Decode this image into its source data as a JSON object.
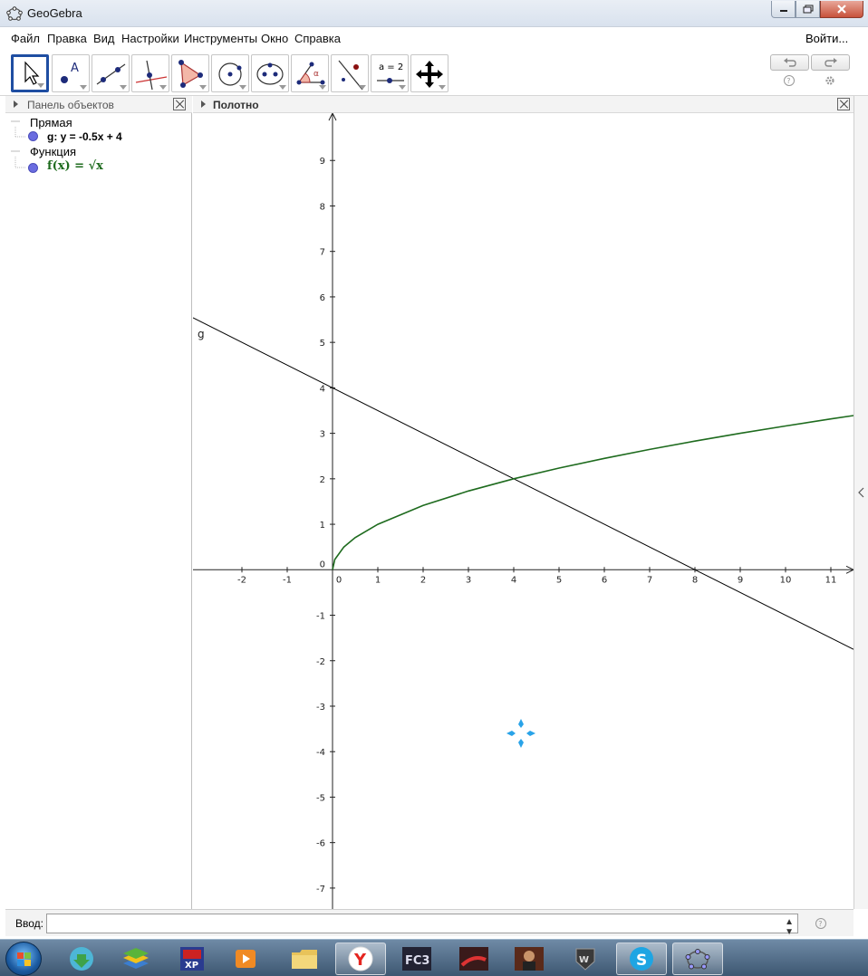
{
  "window": {
    "title": "GeoGebra"
  },
  "menu": {
    "items": [
      "Файл",
      "Правка",
      "Вид",
      "Настройки",
      "Инструменты",
      "Окно",
      "Справка"
    ],
    "login": "Войти..."
  },
  "toolbar": {
    "tools": [
      {
        "icon": "move-arrow-icon",
        "active": true
      },
      {
        "icon": "new-point-icon"
      },
      {
        "icon": "line-through-two-points-icon"
      },
      {
        "icon": "perpendicular-line-icon"
      },
      {
        "icon": "polygon-icon"
      },
      {
        "icon": "circle-with-center-icon"
      },
      {
        "icon": "ellipse-icon"
      },
      {
        "icon": "angle-icon"
      },
      {
        "icon": "reflect-about-line-icon"
      },
      {
        "icon": "slider-icon",
        "text": "a = 2"
      },
      {
        "icon": "move-graphics-view-icon"
      }
    ],
    "undo_icon": "undo-icon",
    "redo_icon": "redo-icon"
  },
  "algebra_panel": {
    "title": "Панель объектов",
    "groups": [
      {
        "label": "Прямая",
        "items": [
          {
            "text": "g: y = -0.5x + 4",
            "color": "#000000"
          }
        ]
      },
      {
        "label": "Функция",
        "items": [
          {
            "text": "f(x) = √x",
            "color": "#1e6b1e"
          }
        ]
      }
    ]
  },
  "graphics_panel": {
    "title": "Полотно",
    "line_label": "g"
  },
  "chart_data": {
    "type": "line",
    "x_ticks": [
      -2,
      -1,
      0,
      1,
      2,
      3,
      4,
      5,
      6,
      7,
      8,
      9,
      10,
      11
    ],
    "y_ticks": [
      -7,
      -6,
      -5,
      -4,
      -3,
      -2,
      -1,
      0,
      1,
      2,
      3,
      4,
      5,
      6,
      7,
      8,
      9
    ],
    "xlim": [
      -3.08,
      11.5
    ],
    "ylim": [
      -7.46,
      10.04
    ],
    "grid": false,
    "series": [
      {
        "name": "g",
        "expr": "-0.5x + 4",
        "x": [
          -3.08,
          11.5
        ],
        "y": [
          5.54,
          -1.75
        ],
        "color": "#000000"
      },
      {
        "name": "f",
        "expr": "sqrt(x)",
        "x": [
          0,
          0.05,
          0.25,
          0.5,
          1,
          2,
          3,
          4,
          5,
          6,
          7,
          8,
          9,
          10,
          11,
          11.5
        ],
        "y": [
          0,
          0.224,
          0.5,
          0.707,
          1,
          1.414,
          1.732,
          2,
          2.236,
          2.449,
          2.646,
          2.828,
          3,
          3.162,
          3.317,
          3.391
        ],
        "color": "#1e6b1e"
      }
    ]
  },
  "input_bar": {
    "label": "Ввод:",
    "value": "",
    "help_icon": "help-icon"
  },
  "taskbar": {
    "items": [
      "start-button",
      "download-icon",
      "bluestacks-icon",
      "xp-icon",
      "media-player-icon",
      "folder-icon",
      "yandex-browser-icon",
      "fc3-game-icon",
      "racing-game-icon",
      "game-character-icon",
      "world-of-tanks-icon",
      "skype-icon",
      "geogebra-icon"
    ]
  }
}
